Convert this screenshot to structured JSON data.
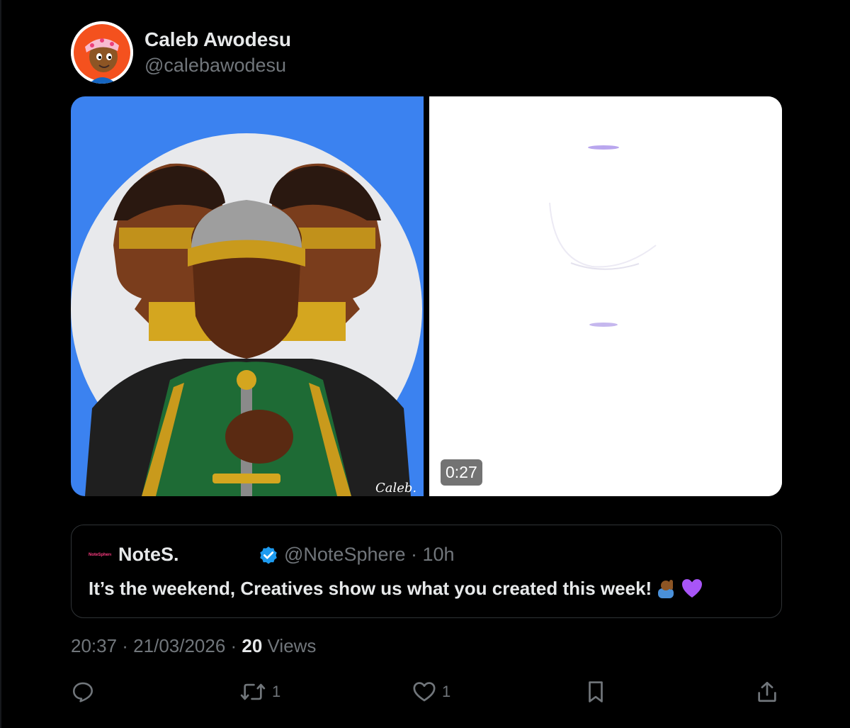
{
  "author": {
    "display_name": "Caleb Awodesu",
    "handle": "@calebawodesu"
  },
  "media": {
    "signature": "Caleb.",
    "video_duration": "0:27"
  },
  "quoted_post": {
    "logo_text": "NoteSphere",
    "name": "NoteS.",
    "handle_time": "@NoteSphere · 10h",
    "text": "It’s the weekend, Creatives show us what you created this week!"
  },
  "meta": {
    "timestamp": "20:37 · 21/03/2026 · ",
    "views_count": "20",
    "views_label": " Views"
  },
  "actions": {
    "reply_count": "",
    "repost_count": "1",
    "like_count": "1"
  },
  "colors": {
    "background": "#000000",
    "primary_text": "#e7e9ea",
    "secondary_text": "#71767b",
    "border": "#2f3336",
    "verified": "#1d9bf0",
    "heart_emoji": "#a855f7"
  }
}
